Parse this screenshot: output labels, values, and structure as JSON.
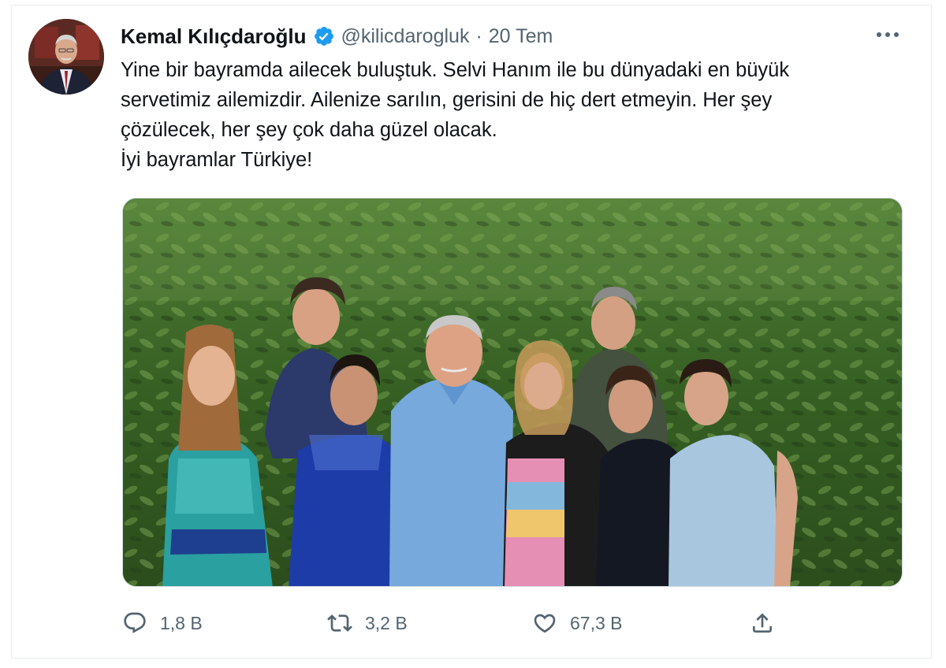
{
  "tweet": {
    "author": {
      "display_name": "Kemal Kılıçdaroğlu",
      "handle": "@kilicdarogluk",
      "separator": "·",
      "date": "20 Tem",
      "verified": true
    },
    "text_lines": [
      "Yine bir bayramda ailecek buluştuk. Selvi Hanım ile bu dünyadaki en büyük",
      "servetimiz ailemizdir. Ailenize sarılın, gerisini de hiç dert etmeyin. Her şey",
      "çözülecek, her şey çok daha güzel olacak.",
      "İyi bayramlar Türkiye!"
    ],
    "actions": {
      "reply": {
        "icon": "reply-icon",
        "count": "1,8 B"
      },
      "retweet": {
        "icon": "retweet-icon",
        "count": "3,2 B"
      },
      "like": {
        "icon": "heart-icon",
        "count": "67,3 B"
      },
      "share": {
        "icon": "share-icon"
      }
    }
  },
  "colors": {
    "text_primary": "#0f1419",
    "text_secondary": "#536471",
    "verified_blue": "#1d9bf0",
    "border": "#cfd9de"
  }
}
